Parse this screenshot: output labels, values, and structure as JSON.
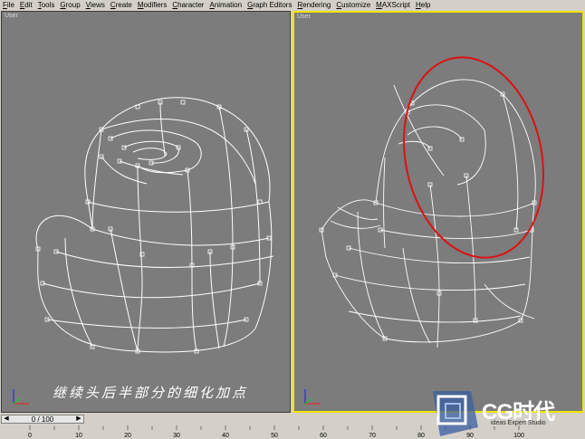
{
  "menu": [
    "File",
    "Edit",
    "Tools",
    "Group",
    "Views",
    "Create",
    "Modifiers",
    "Character",
    "Animation",
    "Graph Editors",
    "Rendering",
    "Customize",
    "MAXScript",
    "Help"
  ],
  "viewports": {
    "left_label": "User",
    "right_label": "User"
  },
  "caption": "继续头后半部分的细化加点",
  "time_slider": {
    "label": "0 / 100"
  },
  "ruler_ticks": [
    "0",
    "10",
    "20",
    "30",
    "40",
    "50",
    "60",
    "70",
    "80",
    "90",
    "100"
  ],
  "logo": {
    "text": "CG时代",
    "subtext": "ideas Expert Studio"
  },
  "colors": {
    "viewport_bg": "#7c7c7c",
    "active_border": "#f0e400",
    "wire": "#ffffff",
    "highlight_ellipse": "#dd1111"
  }
}
